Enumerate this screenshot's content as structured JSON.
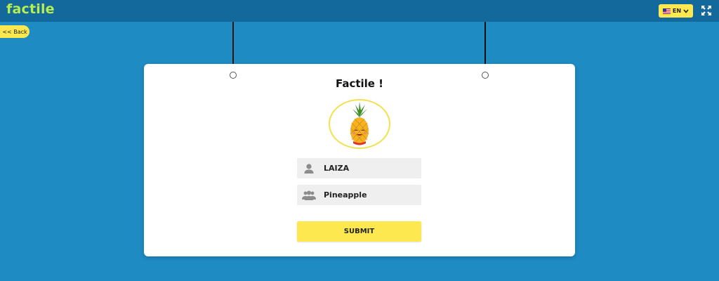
{
  "header": {
    "logo": "factile",
    "language": {
      "label": "EN",
      "flag_icon": "us-flag-icon"
    },
    "fullscreen_icon": "fullscreen-icon"
  },
  "nav": {
    "back_label": "<< Back"
  },
  "form": {
    "title": "Factile !",
    "avatar": "pineapple",
    "name_value": "LAIZA",
    "team_value": "Pineapple",
    "submit_label": "SUBMIT"
  },
  "colors": {
    "background": "#1e8bc3",
    "topbar": "#13699c",
    "logo": "#b7ef4e",
    "accent_yellow": "#fde84f"
  }
}
